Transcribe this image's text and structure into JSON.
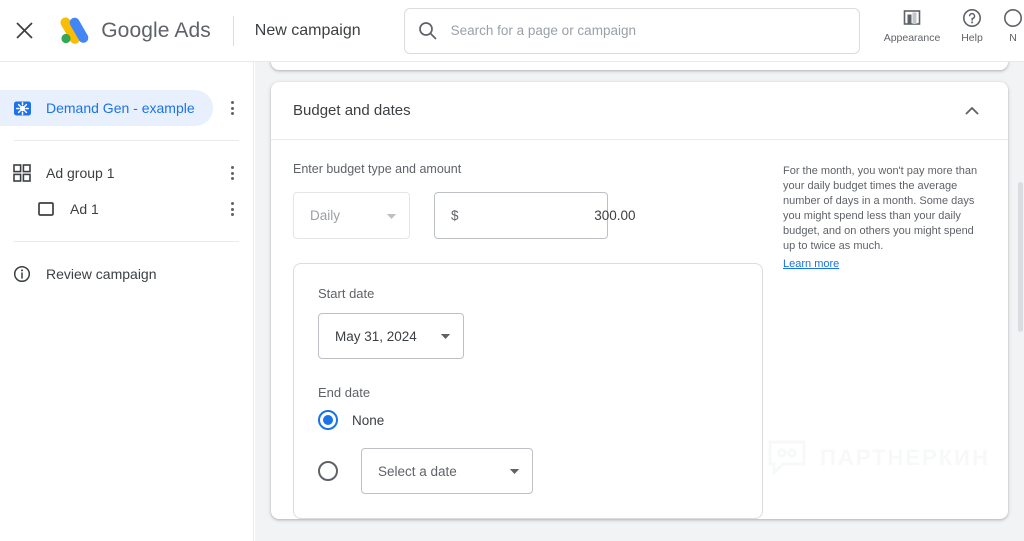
{
  "header": {
    "close_label": "close-icon",
    "brand": "Google Ads",
    "campaign_title": "New campaign",
    "search_placeholder": "Search for a page or campaign",
    "search_value": "",
    "actions": [
      {
        "label": "Appearance",
        "icon": "appearance-icon"
      },
      {
        "label": "Help",
        "icon": "help-icon"
      },
      {
        "label": "N",
        "icon": "notifications-icon"
      }
    ]
  },
  "sidebar": {
    "items": [
      {
        "label": "Demand Gen - example",
        "icon": "demand-gen-icon",
        "selected": true,
        "kebab": true
      },
      {
        "label": "Ad group 1",
        "icon": "ad-group-grid-icon",
        "selected": false,
        "kebab": true
      },
      {
        "label": "Ad 1",
        "icon": "ad-square-icon",
        "selected": false,
        "kebab": true,
        "indented": true
      },
      {
        "label": "Review campaign",
        "icon": "info-circle-icon",
        "selected": false,
        "kebab": false
      }
    ]
  },
  "card": {
    "title": "Budget and dates",
    "collapse_icon": "chevron-up-icon",
    "budget": {
      "label": "Enter budget type and amount",
      "type_value": "Daily",
      "currency_symbol": "$",
      "amount_value": "300.00"
    },
    "help": {
      "text": "For the month, you won't pay more than your daily budget times the average number of days in a month. Some days you might spend less than your daily budget, and on others you might spend up to twice as much.",
      "link": "Learn more"
    },
    "dates": {
      "start_label": "Start date",
      "start_value": "May 31, 2024",
      "end_label": "End date",
      "end_none_label": "None",
      "end_none_selected": true,
      "end_date_placeholder": "Select a date",
      "end_date_selected": false
    }
  },
  "watermark": {
    "text": "ПАРТНЕРКИН"
  },
  "colors": {
    "accent": "#1a73e8",
    "accent_bg": "#e8f0fe",
    "text": "#3c4043",
    "muted": "#5f6368",
    "border": "#dadce0",
    "canvas": "#f1f3f4"
  }
}
